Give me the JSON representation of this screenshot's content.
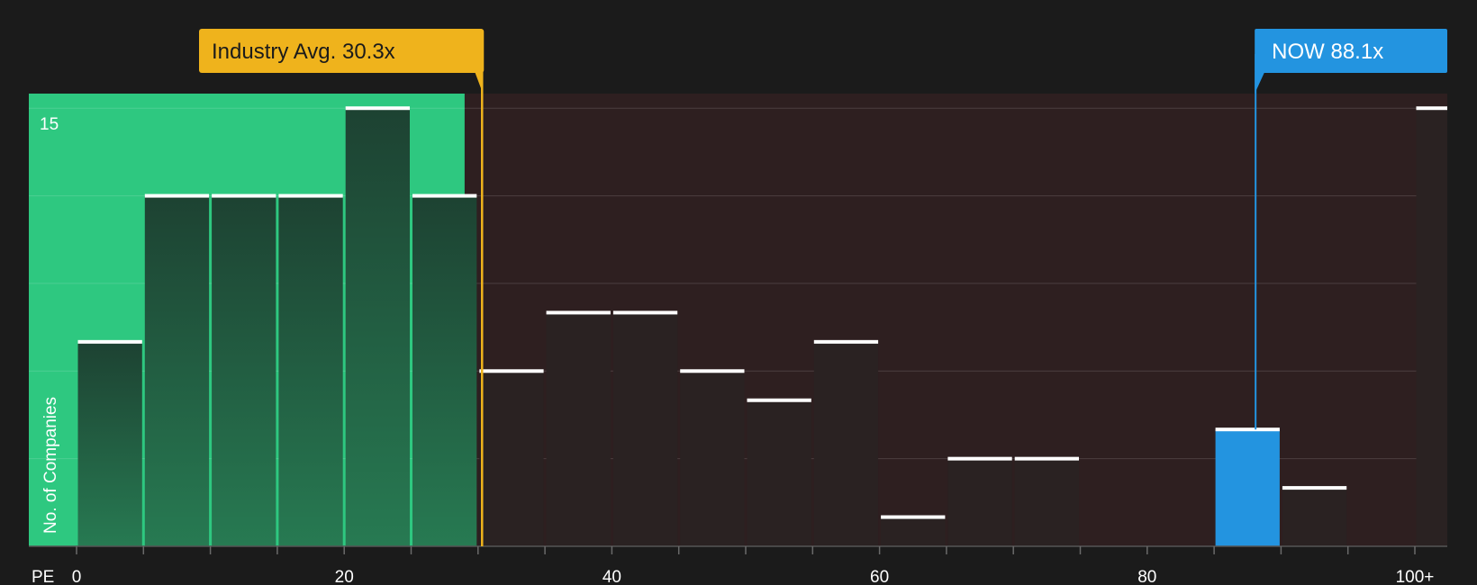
{
  "chart_data": {
    "type": "bar",
    "x_axis_label": "PE",
    "y_axis_label": "No. of Companies",
    "y_tick_label": "15",
    "ylim": [
      0,
      15.5
    ],
    "xlim": [
      -3.6,
      102.7
    ],
    "x_ticks": [
      {
        "value": 0,
        "label": "0"
      },
      {
        "value": 20,
        "label": "20"
      },
      {
        "value": 40,
        "label": "40"
      },
      {
        "value": 60,
        "label": "60"
      },
      {
        "value": 80,
        "label": "80"
      },
      {
        "value": 100,
        "label": "100+"
      }
    ],
    "bin_width": 5,
    "bins": [
      {
        "start": 0,
        "count": 7
      },
      {
        "start": 5,
        "count": 12
      },
      {
        "start": 10,
        "count": 12
      },
      {
        "start": 15,
        "count": 12
      },
      {
        "start": 20,
        "count": 15
      },
      {
        "start": 25,
        "count": 12
      },
      {
        "start": 30,
        "count": 6
      },
      {
        "start": 35,
        "count": 8
      },
      {
        "start": 40,
        "count": 8
      },
      {
        "start": 45,
        "count": 6
      },
      {
        "start": 50,
        "count": 5
      },
      {
        "start": 55,
        "count": 7
      },
      {
        "start": 60,
        "count": 1
      },
      {
        "start": 65,
        "count": 3
      },
      {
        "start": 70,
        "count": 3
      },
      {
        "start": 75,
        "count": 0
      },
      {
        "start": 80,
        "count": 0
      },
      {
        "start": 85,
        "count": 4
      },
      {
        "start": 90,
        "count": 2
      },
      {
        "start": 95,
        "count": 0
      },
      {
        "start": 100,
        "count": 15
      }
    ],
    "good_value_upper": 29,
    "industry_avg": {
      "value": 30.3,
      "label": "Industry Avg. 30.3x"
    },
    "company": {
      "value": 88.1,
      "label": "NOW 88.1x",
      "bin_start": 85
    },
    "grid": true
  },
  "colors": {
    "background": "#1b1b1b",
    "good_zone": "#2ec880",
    "bad_zone": "#2e1f20",
    "bar_dark": "#1f4a36",
    "bar_neutral": "#2a2222",
    "industry": "#efb31c",
    "company": "#2394e0"
  }
}
